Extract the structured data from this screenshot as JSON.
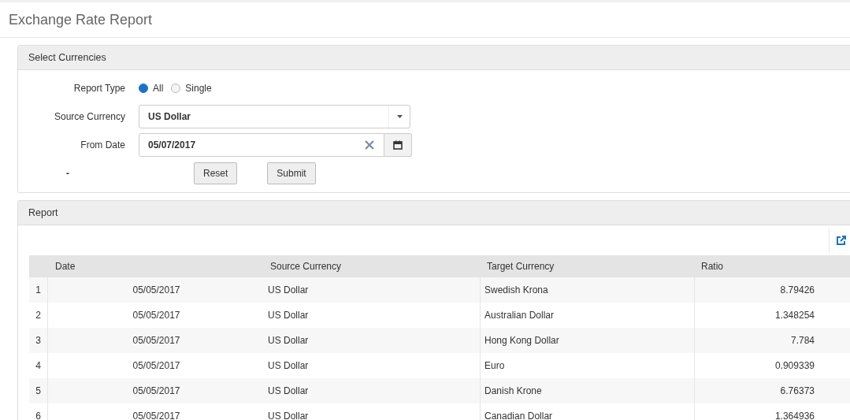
{
  "page": {
    "title": "Exchange Rate Report"
  },
  "select_panel": {
    "title": "Select Currencies",
    "report_type": {
      "label": "Report Type",
      "options": [
        {
          "label": "All",
          "selected": true
        },
        {
          "label": "Single",
          "selected": false
        }
      ]
    },
    "source_currency": {
      "label": "Source Currency",
      "value": "US Dollar"
    },
    "from_date": {
      "label": "From Date",
      "value": "05/07/2017"
    },
    "dash": "-",
    "buttons": [
      "Reset",
      "Submit"
    ]
  },
  "report_panel": {
    "title": "Report",
    "table": {
      "columns": [
        "Date",
        "Source Currency",
        "Target Currency",
        "Ratio"
      ],
      "rows": [
        {
          "index": "1",
          "date": "05/05/2017",
          "source": "US Dollar",
          "target": "Swedish Krona",
          "ratio": "8.79426"
        },
        {
          "index": "2",
          "date": "05/05/2017",
          "source": "US Dollar",
          "target": "Australian Dollar",
          "ratio": "1.348254"
        },
        {
          "index": "3",
          "date": "05/05/2017",
          "source": "US Dollar",
          "target": "Hong Kong Dollar",
          "ratio": "7.784"
        },
        {
          "index": "4",
          "date": "05/05/2017",
          "source": "US Dollar",
          "target": "Euro",
          "ratio": "0.909339"
        },
        {
          "index": "5",
          "date": "05/05/2017",
          "source": "US Dollar",
          "target": "Danish Krone",
          "ratio": "6.76373"
        },
        {
          "index": "6",
          "date": "05/05/2017",
          "source": "US Dollar",
          "target": "Canadian Dollar",
          "ratio": "1.364936"
        }
      ]
    }
  }
}
